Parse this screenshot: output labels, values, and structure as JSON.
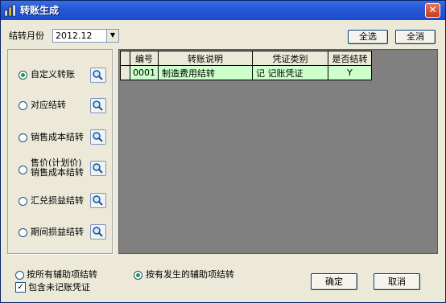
{
  "window": {
    "title": "转账生成"
  },
  "period": {
    "label": "结转月份",
    "value": "2012.12"
  },
  "toolbar": {
    "select_all": "全选",
    "cancel_all": "全消"
  },
  "options": [
    {
      "label": "自定义转账",
      "checked": true
    },
    {
      "label": "对应结转",
      "checked": false
    },
    {
      "label": "销售成本结转",
      "checked": false
    },
    {
      "label_line1": "售价(计划价)",
      "label_line2": "销售成本结转",
      "checked": false
    },
    {
      "label": "汇兑损益结转",
      "checked": false
    },
    {
      "label": "期间损益结转",
      "checked": false
    }
  ],
  "table": {
    "headers": [
      "编号",
      "转账说明",
      "凭证类别",
      "是否结转"
    ],
    "rows": [
      {
        "code": "0001",
        "desc": "制造费用结转",
        "voucher": "记  记账凭证",
        "done": "Y"
      }
    ]
  },
  "footer": {
    "radio_all": "按所有辅助项结转",
    "radio_occurred": "按有发生的辅助项结转",
    "include_unposted": "包含未记账凭证",
    "confirm": "确定",
    "cancel": "取消"
  }
}
